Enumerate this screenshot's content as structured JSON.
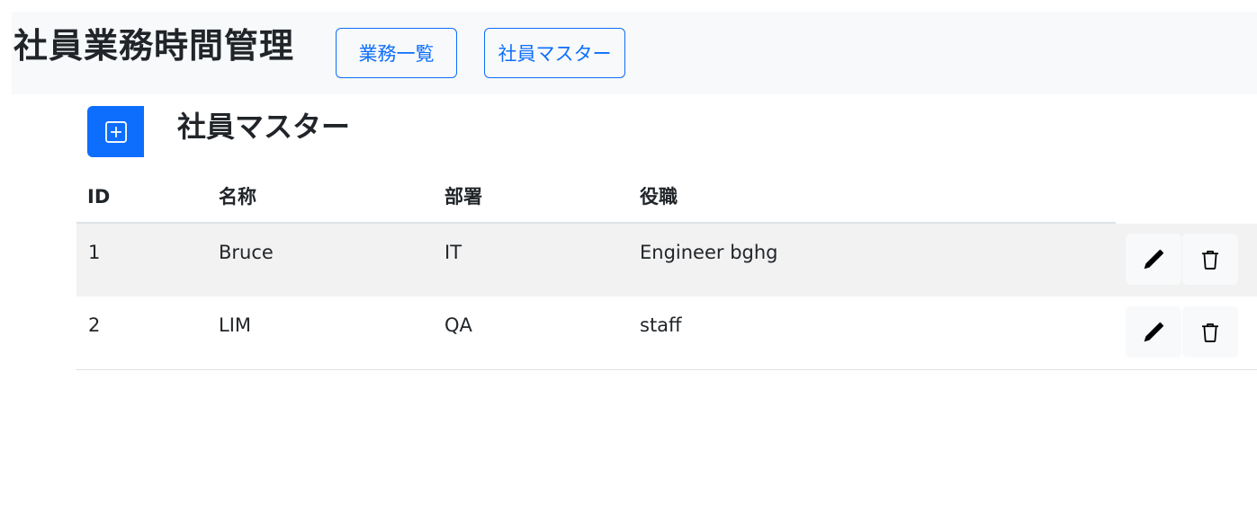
{
  "header": {
    "title": "社員業務時間管理",
    "nav": [
      {
        "label": "業務一覧"
      },
      {
        "label": "社員マスター"
      }
    ]
  },
  "page": {
    "title": "社員マスター",
    "add_icon": "plus-square-icon"
  },
  "table": {
    "columns": [
      "ID",
      "名称",
      "部署",
      "役職"
    ],
    "rows": [
      {
        "id": "1",
        "name": "Bruce",
        "dept": "IT",
        "position": "Engineer bghg"
      },
      {
        "id": "2",
        "name": "LIM",
        "dept": "QA",
        "position": "staff"
      }
    ],
    "row_actions": [
      "pencil-icon",
      "trash-icon"
    ]
  },
  "colors": {
    "primary": "#0d6efd",
    "navbar_bg": "#f8f9fa",
    "striped_row": "#f2f2f2",
    "text": "#212529"
  }
}
